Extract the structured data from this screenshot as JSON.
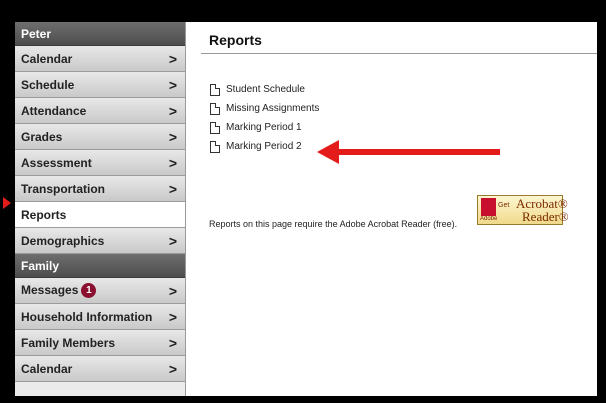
{
  "colors": {
    "annotation_red": "#e31b1b",
    "badge": "#8b0f2e"
  },
  "sidebar": {
    "header": "Peter",
    "items": [
      {
        "label": "Calendar",
        "chevron": ">"
      },
      {
        "label": "Schedule",
        "chevron": ">"
      },
      {
        "label": "Attendance",
        "chevron": ">"
      },
      {
        "label": "Grades",
        "chevron": ">"
      },
      {
        "label": "Assessment",
        "chevron": ">"
      },
      {
        "label": "Transportation",
        "chevron": ">"
      },
      {
        "label": "Reports",
        "active": true
      },
      {
        "label": "Demographics",
        "chevron": ">"
      }
    ],
    "family_header": "Family",
    "family_items": [
      {
        "label": "Messages",
        "badge": "1",
        "chevron": ">"
      },
      {
        "label": "Household Information",
        "chevron": ">"
      },
      {
        "label": "Family Members",
        "chevron": ">"
      },
      {
        "label": "Calendar",
        "chevron": ">"
      }
    ]
  },
  "main": {
    "title": "Reports",
    "reports": [
      {
        "label": "Student Schedule",
        "icon": "document-icon"
      },
      {
        "label": "Missing Assignments",
        "icon": "document-icon"
      },
      {
        "label": "Marking Period 1",
        "icon": "document-icon"
      },
      {
        "label": "Marking Period 2",
        "icon": "document-icon"
      }
    ],
    "acrobat_note": "Reports on this page require the Adobe Acrobat Reader (free).",
    "acrobat_badge": {
      "get": "Get",
      "name": "Acrobat®",
      "reader": "Reader®",
      "adobe": "Adobe"
    }
  }
}
